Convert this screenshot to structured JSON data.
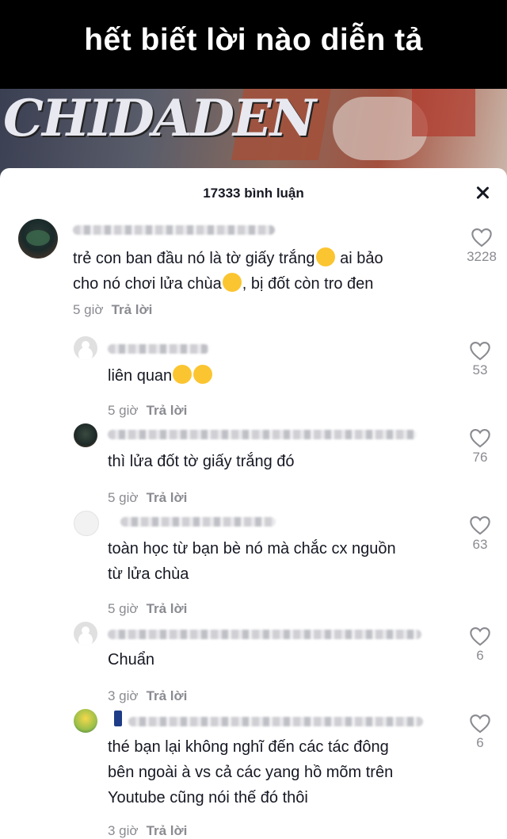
{
  "video": {
    "caption": "hết biết lời nào diễn tả",
    "logo_text": "CHIDADEN"
  },
  "sheet": {
    "title": "17333 bình luận"
  },
  "reply_label": "Trả lời",
  "comments": [
    {
      "text_lines": [
        "trẻ con ban đầu nó là tờ giấy trắng",
        "ai bảo",
        "cho nó chơi lửa chùa",
        ", bị đốt còn tro đen"
      ],
      "time": "5 giờ",
      "likes": "3228"
    },
    {
      "text": "liên quan",
      "time": "5 giờ",
      "likes": "53"
    },
    {
      "text": "thì lửa đốt tờ giấy trắng đó",
      "time": "5 giờ",
      "likes": "76"
    },
    {
      "text_lines": [
        "toàn học từ bạn bè nó mà chắc cx nguồn",
        "từ lửa chùa"
      ],
      "time": "5 giờ",
      "likes": "63"
    },
    {
      "text": "Chuẩn",
      "time": "3 giờ",
      "likes": "6"
    },
    {
      "text_lines": [
        "thé bạn lại không nghĩ đến các tác đông",
        "bên ngoài à vs cả các yang hồ mõm trên",
        "Youtube cũng nói thế đó thôi"
      ],
      "time": "3 giờ",
      "likes": "6"
    }
  ]
}
